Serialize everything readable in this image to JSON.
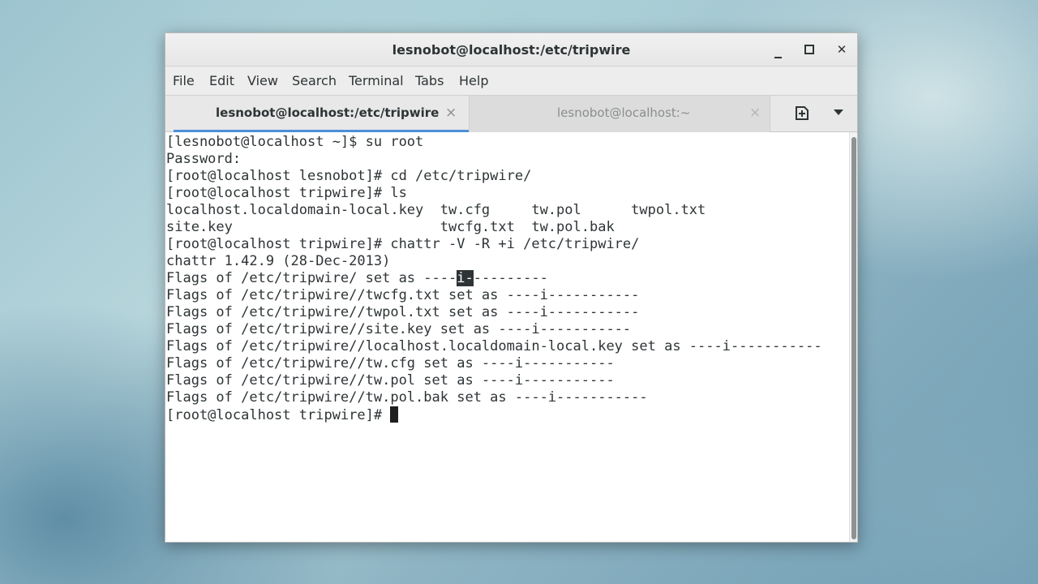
{
  "window": {
    "title": "lesnobot@localhost:/etc/tripwire",
    "controls": {
      "minimize": "minimize-icon",
      "maximize": "maximize-icon",
      "close": "close-icon",
      "close_glyph": "✕"
    }
  },
  "menu": {
    "file": "File",
    "edit": "Edit",
    "view": "View",
    "search": "Search",
    "terminal": "Terminal",
    "tabs": "Tabs",
    "help": "Help"
  },
  "tabs": [
    {
      "label": "lesnobot@localhost:/etc/tripwire",
      "active": true,
      "close_glyph": "×"
    },
    {
      "label": "lesnobot@localhost:~",
      "active": false,
      "close_glyph": "×"
    }
  ],
  "colors": {
    "accent": "#4a90d9",
    "terminal_bg": "#ffffff",
    "terminal_fg": "#2e3436"
  },
  "terminal": {
    "lines": [
      "[lesnobot@localhost ~]$ su root",
      "Password:",
      "[root@localhost lesnobot]# cd /etc/tripwire/",
      "[root@localhost tripwire]# ls",
      "localhost.localdomain-local.key  tw.cfg     tw.pol      twpol.txt",
      "site.key                         twcfg.txt  tw.pol.bak",
      "[root@localhost tripwire]# chattr -V -R +i /etc/tripwire/",
      "chattr 1.42.9 (28-Dec-2013)",
      "Flags of /etc/tripwire/ set as ----",
      "Flags of /etc/tripwire//twcfg.txt set as ----i-----------",
      "Flags of /etc/tripwire//twpol.txt set as ----i-----------",
      "Flags of /etc/tripwire//site.key set as ----i-----------",
      "Flags of /etc/tripwire//localhost.localdomain-local.key set as ----i-----------",
      "Flags of /etc/tripwire//tw.cfg set as ----i-----------",
      "Flags of /etc/tripwire//tw.pol set as ----i-----------",
      "Flags of /etc/tripwire//tw.pol.bak set as ----i-----------",
      "[root@localhost tripwire]# "
    ],
    "selection": "i-",
    "line9_tail": "---------"
  }
}
